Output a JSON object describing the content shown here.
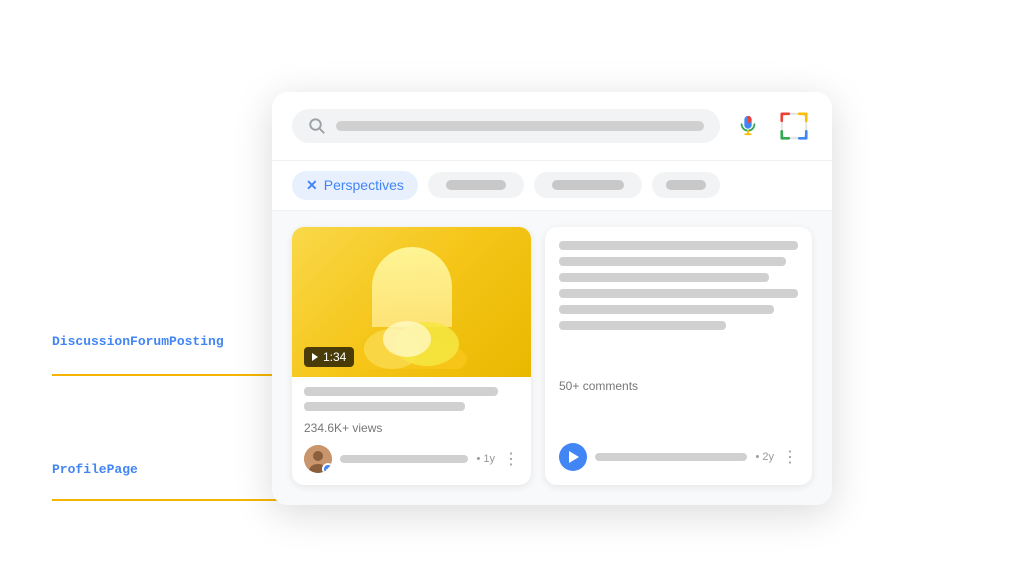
{
  "search": {
    "placeholder": "",
    "mic_label": "voice search",
    "lens_label": "google lens"
  },
  "tabs": [
    {
      "id": "perspectives",
      "label": "Perspectives",
      "active": true
    },
    {
      "id": "tab2",
      "label": "",
      "active": false
    },
    {
      "id": "tab3",
      "label": "",
      "active": false
    },
    {
      "id": "tab4",
      "label": "",
      "active": false
    }
  ],
  "video_card": {
    "duration": "1:34",
    "views": "234.6K+ views",
    "author_time": "• 1y"
  },
  "forum_card": {
    "comments": "50+ comments",
    "author_time": "• 2y"
  },
  "annotations": [
    {
      "id": "discussion",
      "label": "DiscussionForumPosting"
    },
    {
      "id": "profile",
      "label": "ProfilePage"
    }
  ]
}
